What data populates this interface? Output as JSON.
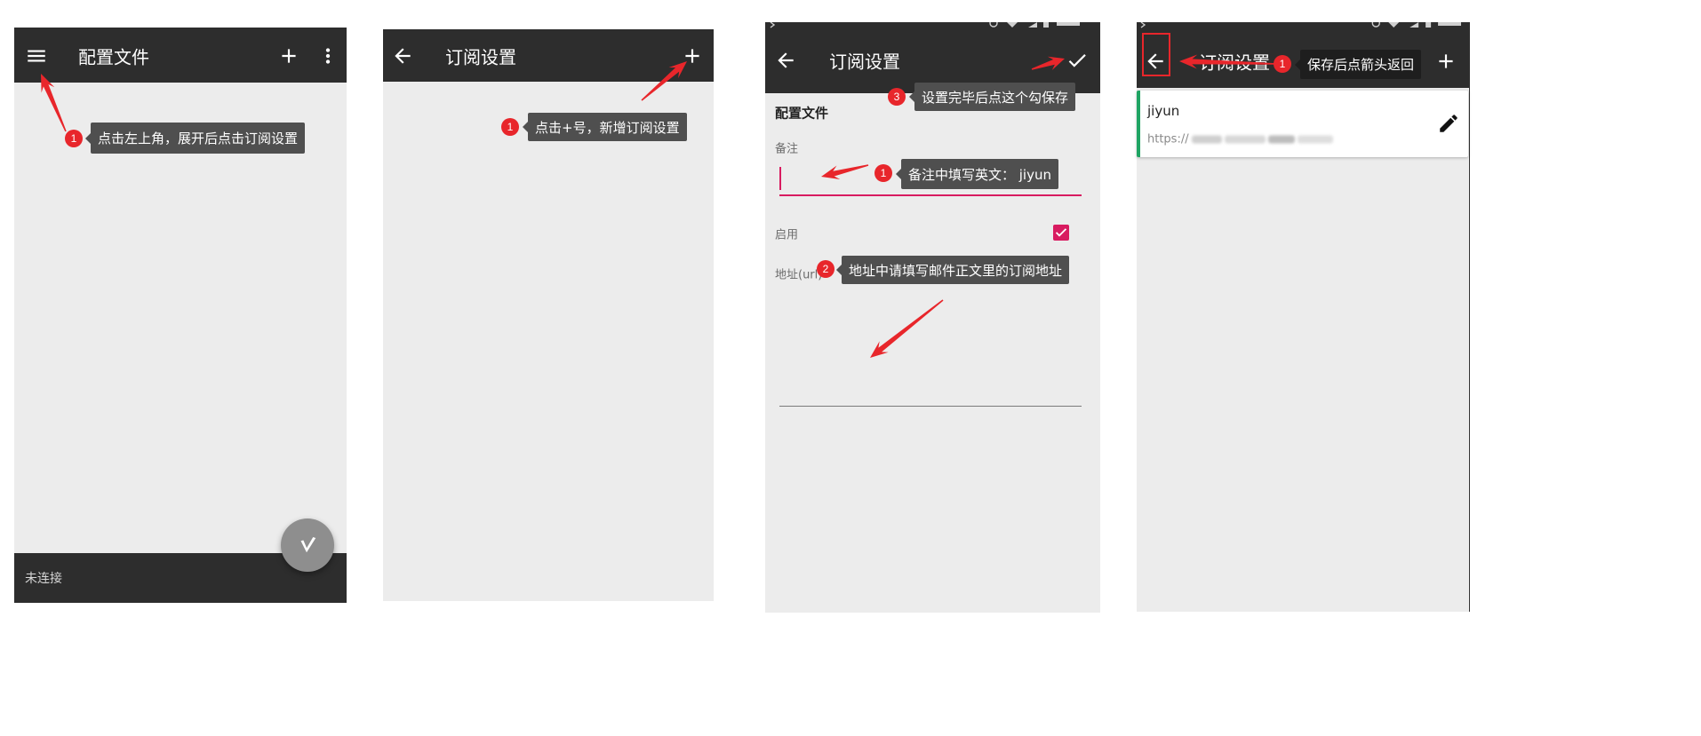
{
  "colors": {
    "toolbar": "#2d2d2d",
    "background": "#ececec",
    "accent": "#d81b60",
    "annotation_red": "#e8262b",
    "tooltip": "#4f4f4f",
    "tooltip_dark": "#1e1e1e",
    "active_indicator": "#1fa463",
    "fab": "#8e8e8e"
  },
  "panel1": {
    "title": "配置文件",
    "status": "未连接",
    "icons": {
      "nav": "menu-icon",
      "add": "add-icon",
      "more": "more-vert-icon",
      "fab": "v-logo-icon"
    },
    "callout": {
      "number": "1",
      "text": "点击左上角，展开后点击订阅设置"
    }
  },
  "panel2": {
    "title": "订阅设置",
    "icons": {
      "back": "arrow-back-icon",
      "add": "add-icon"
    },
    "callout": {
      "number": "1",
      "text": "点击+号，新增订阅设置"
    }
  },
  "panel3": {
    "title": "订阅设置",
    "icons": {
      "back": "arrow-back-icon",
      "save": "check-icon"
    },
    "section_title": "配置文件",
    "remarks_label": "备注",
    "enable_label": "启用",
    "enabled": true,
    "url_label": "地址(url)",
    "callouts": [
      {
        "number": "1",
        "text": "备注中填写英文： jiyun"
      },
      {
        "number": "2",
        "text": "地址中请填写邮件正文里的订阅地址"
      },
      {
        "number": "3",
        "text": "设置完毕后点这个勾保存"
      }
    ]
  },
  "panel4": {
    "title": "订阅设置",
    "icons": {
      "back": "arrow-back-icon",
      "add": "add-icon",
      "edit": "edit-pencil-icon"
    },
    "subscription": {
      "remarks": "jiyun",
      "url_visible": "https://"
    },
    "callout": {
      "number": "1",
      "text": "保存后点箭头返回"
    }
  }
}
